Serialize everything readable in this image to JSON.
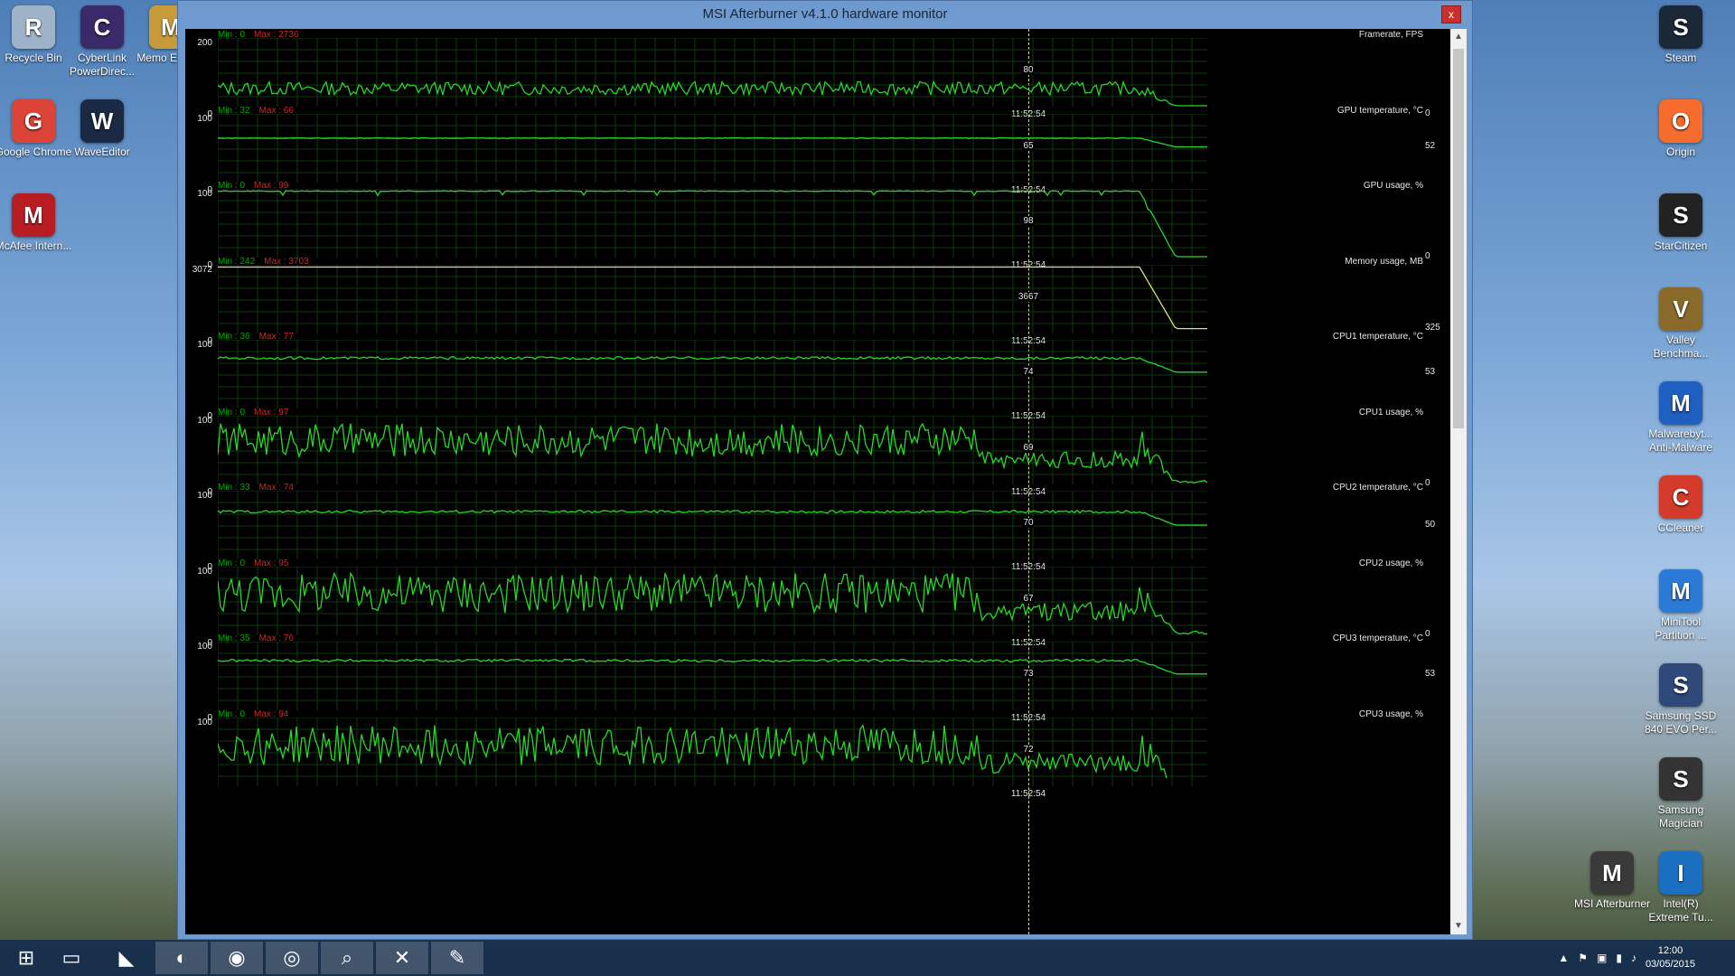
{
  "window": {
    "title": "MSI Afterburner v4.1.0 hardware monitor",
    "close_label": "x"
  },
  "cursor_timestamp": "11:52:54",
  "graphs": [
    {
      "title": "Framerate, FPS",
      "min_label": "Min : 0",
      "max_label": "Max : 2736",
      "ymax": "200",
      "ymin": "0",
      "current": "80",
      "last": "0"
    },
    {
      "title": "GPU temperature, °C",
      "min_label": "Min : 32",
      "max_label": "Max : 66",
      "ymax": "100",
      "ymin": "0",
      "current": "65",
      "last": "52"
    },
    {
      "title": "GPU usage, %",
      "min_label": "Min : 0",
      "max_label": "Max : 99",
      "ymax": "100",
      "ymin": "0",
      "current": "98",
      "last": "0"
    },
    {
      "title": "Memory usage, MB",
      "min_label": "Min : 242",
      "max_label": "Max : 3703",
      "ymax": "3072",
      "ymin": "0",
      "current": "3667",
      "last": "325"
    },
    {
      "title": "CPU1 temperature, °C",
      "min_label": "Min : 36",
      "max_label": "Max : 77",
      "ymax": "100",
      "ymin": "0",
      "current": "74",
      "last": "53"
    },
    {
      "title": "CPU1 usage, %",
      "min_label": "Min : 0",
      "max_label": "Max : 97",
      "ymax": "100",
      "ymin": "0",
      "current": "69",
      "last": "0"
    },
    {
      "title": "CPU2 temperature, °C",
      "min_label": "Min : 33",
      "max_label": "Max : 74",
      "ymax": "100",
      "ymin": "0",
      "current": "70",
      "last": "50"
    },
    {
      "title": "CPU2 usage, %",
      "min_label": "Min : 0",
      "max_label": "Max : 95",
      "ymax": "100",
      "ymin": "0",
      "current": "67",
      "last": "0"
    },
    {
      "title": "CPU3 temperature, °C",
      "min_label": "Min : 35",
      "max_label": "Max : 76",
      "ymax": "100",
      "ymin": "0",
      "current": "73",
      "last": "53"
    },
    {
      "title": "CPU3 usage, %",
      "min_label": "Min : 0",
      "max_label": "Max : 94",
      "ymax": "100",
      "ymin": "",
      "current": "72",
      "last": ""
    }
  ],
  "desktop_left": [
    {
      "label": "Recycle Bin",
      "icon": "recycle-bin-icon",
      "color": "#9fb3c8"
    },
    {
      "label": "CyberLink PowerDirec...",
      "icon": "cyberlink-icon",
      "color": "#3a2a6a"
    },
    {
      "label": "Memo Europe",
      "icon": "memo-icon",
      "color": "#c79a3a"
    },
    {
      "label": "Google Chrome",
      "icon": "chrome-icon",
      "color": "#db4437"
    },
    {
      "label": "WaveEditor",
      "icon": "waveeditor-icon",
      "color": "#1a2a44"
    },
    {
      "label": "McAfee Intern...",
      "icon": "mcafee-icon",
      "color": "#b81d24"
    }
  ],
  "desktop_right": [
    {
      "label": "Steam",
      "icon": "steam-icon",
      "color": "#1b2838"
    },
    {
      "label": "Origin",
      "icon": "origin-icon",
      "color": "#f56c2d"
    },
    {
      "label": "StarCitizen",
      "icon": "starcitizen-icon",
      "color": "#222222"
    },
    {
      "label": "Valley Benchma...",
      "icon": "valley-icon",
      "color": "#8a6a2a"
    },
    {
      "label": "Malwarebyt... Anti-Malware",
      "icon": "malwarebytes-icon",
      "color": "#1f5fbf"
    },
    {
      "label": "CCleaner",
      "icon": "ccleaner-icon",
      "color": "#d33a2a"
    },
    {
      "label": "MiniTool Partition ...",
      "icon": "minitool-icon",
      "color": "#2a7ad6"
    },
    {
      "label": "Samsung SSD 840 EVO Per...",
      "icon": "samsung-ssd-icon",
      "color": "#2f4a7a"
    },
    {
      "label": "Samsung Magician",
      "icon": "samsung-magician-icon",
      "color": "#333333"
    },
    {
      "label": "Intel(R) Extreme Tu...",
      "icon": "intel-xtu-icon",
      "color": "#1a6fc0"
    },
    {
      "label": "MSI Afterburner",
      "icon": "msi-afterburner-icon",
      "color": "#3a3a3a"
    }
  ],
  "taskbar": {
    "items": [
      {
        "name": "start-button",
        "icon": "windows-logo-icon",
        "glyph": "⊞"
      },
      {
        "name": "file-explorer",
        "icon": "folder-icon",
        "glyph": "▭"
      },
      {
        "name": "nvidia",
        "icon": "nvidia-icon",
        "glyph": "◣"
      },
      {
        "name": "cyberlink",
        "icon": "cyberlink-icon",
        "glyph": "◐"
      },
      {
        "name": "chrome",
        "icon": "chrome-icon",
        "glyph": "◉"
      },
      {
        "name": "steam",
        "icon": "steam-icon",
        "glyph": "◎"
      },
      {
        "name": "search-tool",
        "icon": "magnifier-icon",
        "glyph": "⌕"
      },
      {
        "name": "xbox",
        "icon": "xbox-icon",
        "glyph": "✕"
      },
      {
        "name": "paint",
        "icon": "paint-icon",
        "glyph": "✎"
      }
    ],
    "tray_glyphs": [
      "▲",
      "⚑",
      "▣",
      "▮",
      "♪"
    ],
    "time": "12:00",
    "date": "03/05/2015"
  },
  "colors": {
    "graph_line": "#2bd62b",
    "grid": "#0f3a0f",
    "max_red": "#c62a2a"
  }
}
